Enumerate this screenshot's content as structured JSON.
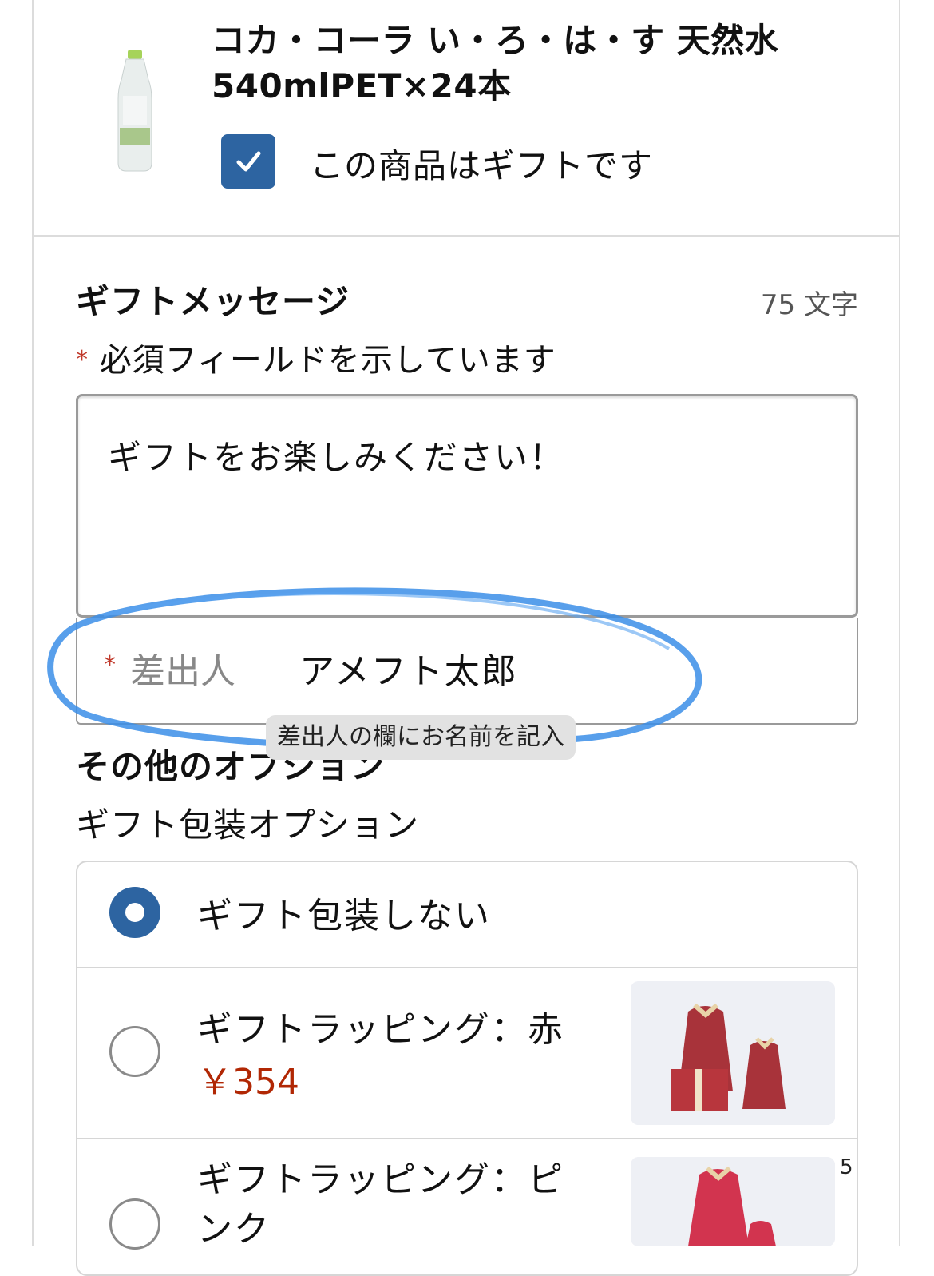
{
  "product": {
    "title": "コカ・コーラ い・ろ・は・す 天然水540mlPET×24本",
    "gift_checkbox_label": "この商品はギフトです",
    "gift_checked": true
  },
  "gift_message": {
    "heading": "ギフトメッセージ",
    "char_count": "75 文字",
    "required_mark": "*",
    "required_note": "必須フィールドを示しています",
    "message": "ギフトをお楽しみください！",
    "sender_label": "差出人",
    "sender_value": "アメフト太郎"
  },
  "annotation": {
    "tooltip": "差出人の欄にお名前を記入",
    "ellipse_color": "#3b8ee8"
  },
  "other_options": {
    "heading": "その他のオプション",
    "wrap_heading": "ギフト包装オプション",
    "options": [
      {
        "label": "ギフト包装しない",
        "selected": true
      },
      {
        "label": "ギフトラッピング：赤",
        "price": "￥354",
        "selected": false
      },
      {
        "label": "ギフトラッピング：ピ",
        "label_line2": "ンク",
        "selected": false
      }
    ]
  },
  "page_marker": "5",
  "colors": {
    "accent": "#2d64a1",
    "price": "#b12704",
    "required": "#c0392b"
  }
}
